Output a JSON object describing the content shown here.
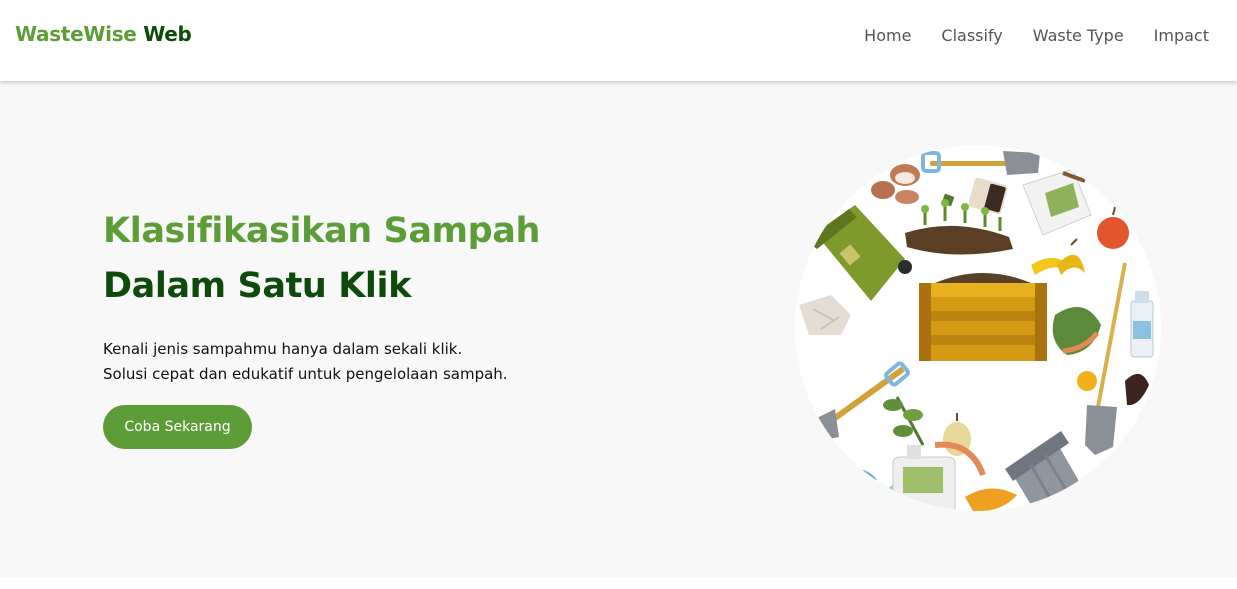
{
  "brand": {
    "part1": "WasteWise",
    "part2": "Web"
  },
  "nav": {
    "items": [
      {
        "label": "Home"
      },
      {
        "label": "Classify"
      },
      {
        "label": "Waste Type"
      },
      {
        "label": "Impact"
      }
    ]
  },
  "hero": {
    "title_line1": "Klasifikasikan Sampah",
    "title_line2": "Dalam Satu Klik",
    "desc_line1": "Kenali jenis sampahmu hanya dalam sekali klik.",
    "desc_line2": "Solusi cepat dan edukatif untuk pengelolaan sampah.",
    "cta_label": "Coba Sekarang"
  },
  "colors": {
    "primary": "#5c9d37",
    "dark_green": "#0e4a0b",
    "hero_bg": "#f8f8f8",
    "nav_text": "#555555"
  }
}
